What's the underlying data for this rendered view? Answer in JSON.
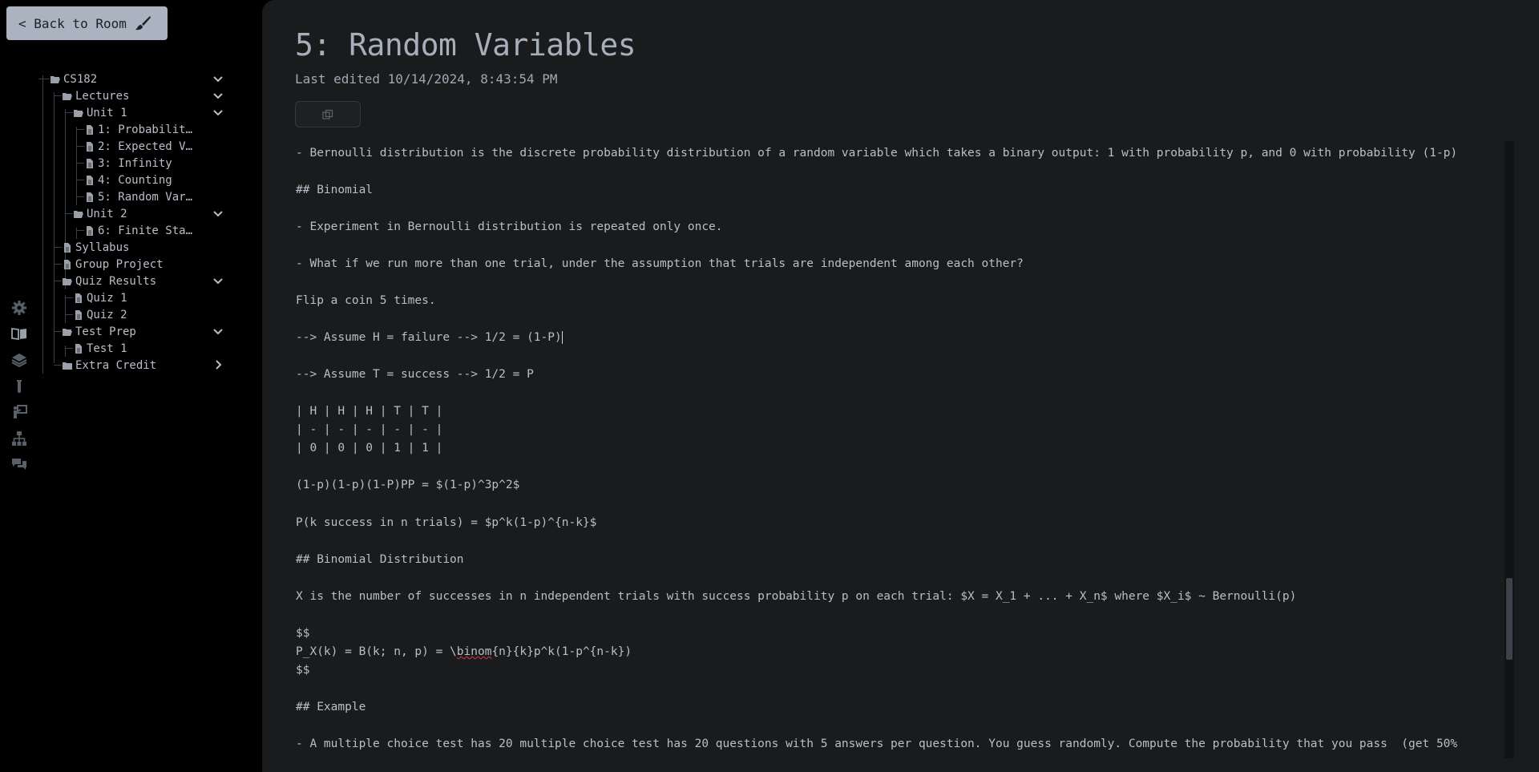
{
  "back_button": {
    "label": "< Back to Room"
  },
  "rail_icons": [
    "gear-icon",
    "book-icon",
    "layers-icon",
    "flask-icon",
    "presentation-icon",
    "sitemap-icon",
    "chat-icon"
  ],
  "tree": {
    "items": [
      {
        "label": "CS182",
        "type": "folder-open",
        "expanded": true
      },
      {
        "label": "Lectures",
        "type": "folder-open",
        "expanded": true
      },
      {
        "label": "Unit 1",
        "type": "folder-open",
        "expanded": true
      },
      {
        "label": "1: Probabilit…",
        "type": "file"
      },
      {
        "label": "2: Expected V…",
        "type": "file"
      },
      {
        "label": "3: Infinity",
        "type": "file"
      },
      {
        "label": "4: Counting",
        "type": "file"
      },
      {
        "label": "5: Random Var…",
        "type": "file"
      },
      {
        "label": "Unit 2",
        "type": "folder-open",
        "expanded": true
      },
      {
        "label": "6: Finite Sta…",
        "type": "file"
      },
      {
        "label": "Syllabus",
        "type": "file"
      },
      {
        "label": "Group Project",
        "type": "file"
      },
      {
        "label": "Quiz Results",
        "type": "folder-open",
        "expanded": true
      },
      {
        "label": "Quiz 1",
        "type": "file"
      },
      {
        "label": "Quiz 2",
        "type": "file"
      },
      {
        "label": "Test Prep",
        "type": "folder-open",
        "expanded": true
      },
      {
        "label": "Test 1",
        "type": "file"
      },
      {
        "label": "Extra Credit",
        "type": "folder-closed",
        "expanded": false
      }
    ]
  },
  "page": {
    "title": "5: Random Variables",
    "last_edited": "Last edited 10/14/2024, 8:43:54 PM"
  },
  "editor": {
    "lines": [
      "- Bernoulli distribution is the discrete probability distribution of a random variable which takes a binary output: 1 with probability p, and 0 with probability (1-p)",
      "## Binomial",
      "- Experiment in Bernoulli distribution is repeated only once.",
      "- What if we run more than one trial, under the assumption that trials are independent among each other?",
      "Flip a coin 5 times.",
      "--> Assume H = failure --> 1/2 = (1-P)",
      "--> Assume T = success --> 1/2 = P",
      "| H | H | H | T | T |",
      "| - | - | - | - | - |",
      "| 0 | 0 | 0 | 1 | 1 |",
      "(1-p)(1-p)(1-P)PP = $(1-p)^3p^2$",
      "P(k success in n trials) = $p^k(1-p)^{n-k}$",
      "## Binomial Distribution",
      "X is the number of successes in n independent trials with success probability p on each trial: $X = X_1 + ... + X_n$ where $X_i$ ~ Bernoulli(p)",
      "$$",
      "P_X(k) = B(k; n, p) = \\",
      "binom",
      "{n}{k}p^k(1-p^{n-k})",
      "$$",
      "## Example",
      "- A multiple choice test has 20 multiple choice test has 20 questions with 5 answers per question. You guess randomly. Compute the probability that you pass  (get 50%"
    ]
  }
}
